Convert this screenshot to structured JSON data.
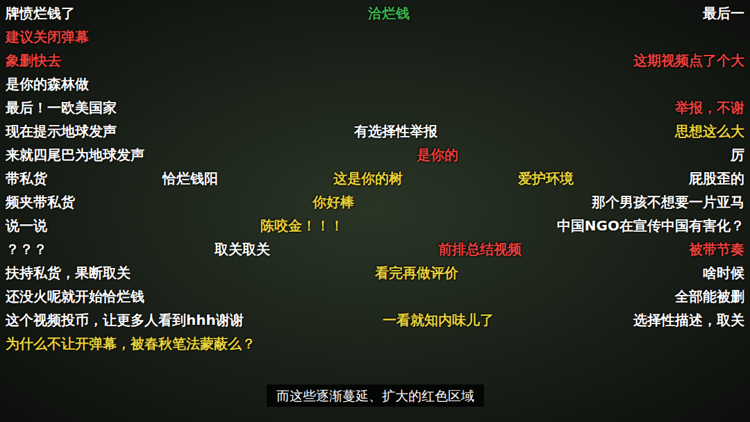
{
  "danmaku_rows": [
    {
      "comments": [
        {
          "text": "牌愤烂钱了",
          "color": "#ffffff"
        },
        {
          "text": "洽烂钱",
          "color": "#3cb44b"
        },
        {
          "text": "最后一",
          "color": "#ffffff"
        }
      ]
    },
    {
      "comments": [
        {
          "text": "建议关闭弹幕",
          "color": "#e8413c"
        }
      ]
    },
    {
      "comments": [
        {
          "text": "象删快去",
          "color": "#e8413c"
        },
        {
          "text": "这期视频点了个大",
          "color": "#e8413c"
        }
      ]
    },
    {
      "comments": [
        {
          "text": "是你的森林做",
          "color": "#ffffff"
        }
      ]
    },
    {
      "comments": [
        {
          "text": "最后！一欧美国家",
          "color": "#ffffff"
        },
        {
          "text": "举报，不谢",
          "color": "#e8413c"
        }
      ]
    },
    {
      "comments": [
        {
          "text": "现在提示地球发声",
          "color": "#ffffff"
        },
        {
          "text": "有选择性举报",
          "color": "#ffffff"
        },
        {
          "text": "思想这么大",
          "color": "#e8d23a"
        }
      ]
    },
    {
      "comments": [
        {
          "text": "来就四尾巴为地球发声",
          "color": "#ffffff"
        },
        {
          "text": "是你的",
          "color": "#e8413c"
        },
        {
          "text": "厉",
          "color": "#ffffff"
        }
      ]
    },
    {
      "comments": [
        {
          "text": "带私货",
          "color": "#ffffff"
        },
        {
          "text": "恰烂钱阳",
          "color": "#ffffff"
        },
        {
          "text": "这是你的树",
          "color": "#e8d23a"
        },
        {
          "text": "爱护环境",
          "color": "#e8d23a"
        },
        {
          "text": "屁股歪的",
          "color": "#ffffff"
        }
      ]
    },
    {
      "comments": [
        {
          "text": "频夹带私货",
          "color": "#ffffff"
        },
        {
          "text": "你好棒",
          "color": "#e8d23a"
        },
        {
          "text": "那个男孩不想要一片亚马",
          "color": "#ffffff"
        }
      ]
    },
    {
      "comments": [
        {
          "text": "说一说",
          "color": "#ffffff"
        },
        {
          "text": "陈咬金！！！",
          "color": "#e8d23a"
        },
        {
          "text": "中国NGO在宣传中国有害化？",
          "color": "#ffffff"
        }
      ]
    },
    {
      "comments": [
        {
          "text": "？？？",
          "color": "#ffffff"
        },
        {
          "text": "取关取关",
          "color": "#ffffff"
        },
        {
          "text": "前排总结视频",
          "color": "#e8413c"
        },
        {
          "text": "被带节奏",
          "color": "#e8413c"
        }
      ]
    },
    {
      "comments": [
        {
          "text": "扶持私货，果断取关",
          "color": "#ffffff"
        },
        {
          "text": "看完再做评价",
          "color": "#e8d23a"
        },
        {
          "text": "啥时候",
          "color": "#ffffff"
        }
      ]
    },
    {
      "comments": [
        {
          "text": "还没火呢就开始恰烂钱",
          "color": "#ffffff"
        },
        {
          "text": "全部能被删",
          "color": "#ffffff"
        }
      ]
    },
    {
      "comments": [
        {
          "text": "这个视频投币，让更多人看到hhh谢谢",
          "color": "#ffffff"
        },
        {
          "text": "一看就知内味儿了",
          "color": "#e8d23a"
        },
        {
          "text": "选择性描述，取关",
          "color": "#ffffff"
        }
      ]
    },
    {
      "comments": [
        {
          "text": "为什么不让开弹幕，被春秋笔法蒙蔽么？",
          "color": "#e8d23a"
        }
      ]
    }
  ],
  "subtitle": "而这些逐渐蔓延、扩大的红色区域"
}
